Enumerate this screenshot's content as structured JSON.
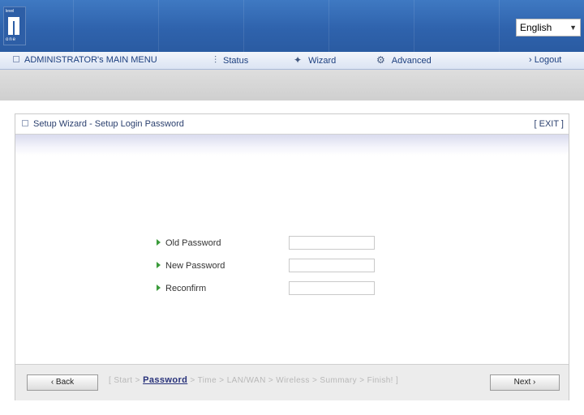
{
  "header": {
    "logo_top_text": "level",
    "logo_bottom_text": "one",
    "language": {
      "selected": "English",
      "icon": "chevron-down-icon"
    }
  },
  "menu": {
    "main_menu_label": "ADMINISTRATOR's MAIN MENU",
    "items": [
      {
        "label": "Status",
        "icon": "status-icon"
      },
      {
        "label": "Wizard",
        "icon": "wizard-icon"
      },
      {
        "label": "Advanced",
        "icon": "advanced-icon"
      }
    ],
    "logout_label": "› Logout"
  },
  "panel": {
    "title": "Setup Wizard - Setup Login Password",
    "exit_label": "[ EXIT ]"
  },
  "form": {
    "fields": [
      {
        "label": "Old Password",
        "value": ""
      },
      {
        "label": "New Password",
        "value": ""
      },
      {
        "label": "Reconfirm",
        "value": ""
      }
    ]
  },
  "nav": {
    "back_label": "‹ Back",
    "next_label": "Next ›",
    "steps_prefix": "[ Start > ",
    "current_step": "Password",
    "steps_suffix": " > Time > LAN/WAN > Wireless > Summary > Finish! ]"
  },
  "colors": {
    "header_blue": "#2f63ad",
    "menu_text": "#1c3f7f",
    "label_arrow_green": "#3a9b3a",
    "current_step": "#27317a"
  }
}
